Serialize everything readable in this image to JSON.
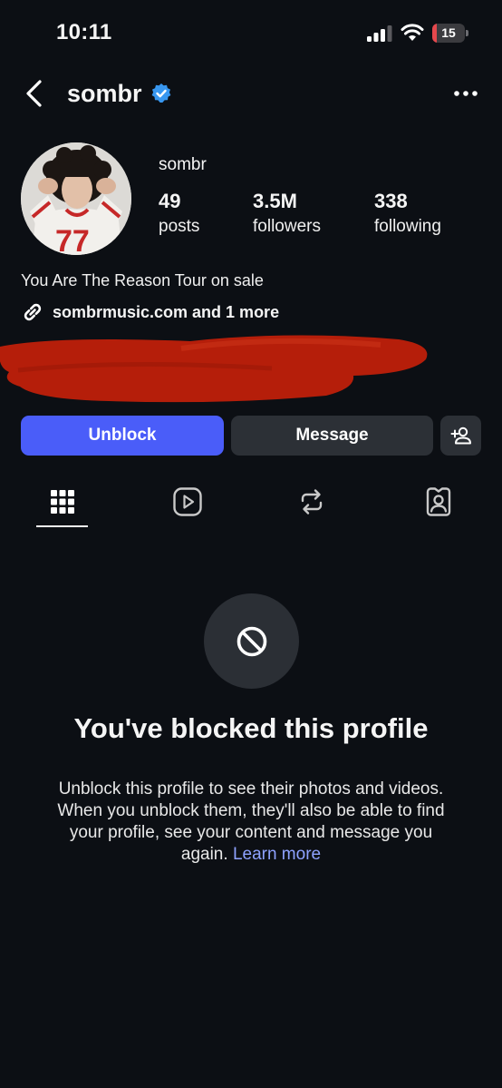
{
  "status_bar": {
    "time": "10:11",
    "battery_level": "15",
    "battery_fraction": 0.15,
    "battery_color": "#e5484d"
  },
  "nav": {
    "title": "sombr",
    "back_icon": "chevron-left-icon",
    "verified_icon": "verified-badge-icon",
    "more_icon": "more-horizontal-icon"
  },
  "profile": {
    "username": "sombr",
    "stats": {
      "posts_count": "49",
      "posts_label": "posts",
      "followers_count": "3.5M",
      "followers_label": "followers",
      "following_count": "338",
      "following_label": "following"
    },
    "bio": "You Are The Reason Tour on sale",
    "link_icon": "link-icon",
    "link_text": "sombrmusic.com and 1 more"
  },
  "actions": {
    "unblock_label": "Unblock",
    "message_label": "Message",
    "suggest_icon": "add-person-icon",
    "unblock_color": "#4a5df9"
  },
  "tabs": [
    {
      "icon": "grid-icon",
      "active": true
    },
    {
      "icon": "reels-icon",
      "active": false
    },
    {
      "icon": "repost-icon",
      "active": false
    },
    {
      "icon": "tagged-icon",
      "active": false
    }
  ],
  "blocked": {
    "icon": "block-icon",
    "title": "You've blocked this profile",
    "body": "Unblock this profile to see their photos and videos. When you unblock them, they'll also be able to find your profile, see your content and message you again.",
    "learn_more": "Learn more"
  }
}
